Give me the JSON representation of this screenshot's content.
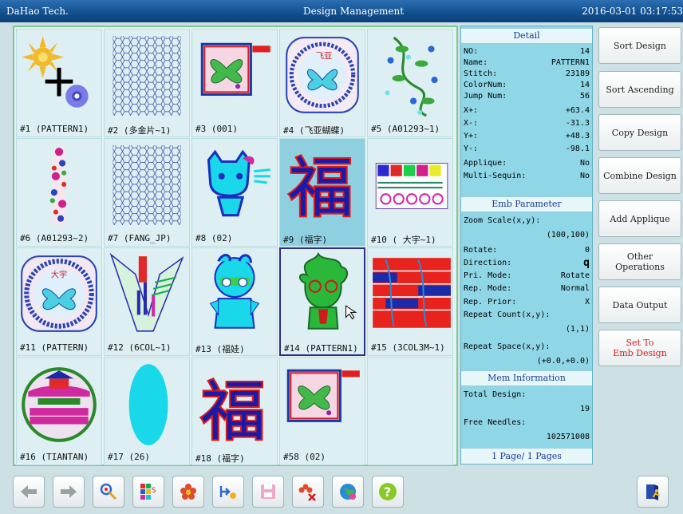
{
  "titlebar": {
    "brand": "DaHao Tech.",
    "title": "Design Management",
    "datetime": "2016-03-01 03:17:53"
  },
  "designs": [
    {
      "caption": "#1   (PATTERN1)"
    },
    {
      "caption": "#2   (多金片~1)"
    },
    {
      "caption": "#3   (001)"
    },
    {
      "caption": "#4   (飞亚蝴蝶)"
    },
    {
      "caption": "#5   (A01293~1)"
    },
    {
      "caption": "#6   (A01293~2)"
    },
    {
      "caption": "#7   (FANG_JP)"
    },
    {
      "caption": "#8   (02)"
    },
    {
      "caption": "#9   (福字)"
    },
    {
      "caption": "#10  ( 大宇~1)"
    },
    {
      "caption": "#11  (PATTERN)"
    },
    {
      "caption": "#12  (6COL~1)"
    },
    {
      "caption": "#13  (福娃)"
    },
    {
      "caption": "#14  (PATTERN1)"
    },
    {
      "caption": "#15  (3COL3M~1)"
    },
    {
      "caption": "#16  (TIANTAN)"
    },
    {
      "caption": "#17   (26)"
    },
    {
      "caption": "#18  (福字)"
    },
    {
      "caption": "#58  (02)"
    }
  ],
  "selected_index": 14,
  "detail": {
    "title": "Detail",
    "no": {
      "label": "NO:",
      "value": "14"
    },
    "name": {
      "label": "Name:",
      "value": "PATTERN1"
    },
    "stitch": {
      "label": "Stitch:",
      "value": "23189"
    },
    "colornum": {
      "label": "ColorNum:",
      "value": "14"
    },
    "jumpnum": {
      "label": "Jump Num:",
      "value": "56"
    },
    "xplus": {
      "label": "X+:",
      "value": "+63.4"
    },
    "xminus": {
      "label": "X-:",
      "value": "-31.3"
    },
    "yplus": {
      "label": "Y+:",
      "value": "+48.3"
    },
    "yminus": {
      "label": "Y-:",
      "value": "-98.1"
    },
    "applique": {
      "label": "Applique:",
      "value": "No"
    },
    "multisequin": {
      "label": "Multi-Sequin:",
      "value": "No"
    }
  },
  "emb": {
    "title": "Emb Parameter",
    "zoom_label": "Zoom Scale(x,y):",
    "zoom_value": "(100,100)",
    "rotate": {
      "label": "Rotate:",
      "value": "0"
    },
    "direction": {
      "label": "Direction:",
      "value": "q"
    },
    "pri_mode": {
      "label": "Pri. Mode:",
      "value": "Rotate"
    },
    "rep_mode": {
      "label": "Rep. Mode:",
      "value": "Normal"
    },
    "rep_prior": {
      "label": "Rep. Prior:",
      "value": "X"
    },
    "repeat_count_label": "Repeat Count(x,y):",
    "repeat_count_value": "(1,1)",
    "repeat_space_label": "Repeat Space(x,y):",
    "repeat_space_value": "(+0.0,+0.0)"
  },
  "mem": {
    "title": "Mem Information",
    "total_label": "Total Design:",
    "total_value": "19",
    "free_label": "Free Needles:",
    "free_value": "102571008"
  },
  "page_indicator": "1 Page/ 1 Pages",
  "side_buttons": {
    "sort_design": "Sort Design",
    "sort_ascending": "Sort Ascending",
    "copy_design": "Copy Design",
    "combine_design": "Combine Design",
    "add_applique": "Add Applique",
    "other_operations": "Other\nOperations",
    "data_output": "Data Output",
    "set_to_emb": "Set To\nEmb Design"
  },
  "colors": {
    "accent": "#114f8e",
    "panel": "#8fd6e6",
    "set_to_emb_text": "#d21b1b",
    "grid_border": "#7cc98c"
  },
  "toolbar_icons": [
    "arrow-left-icon",
    "arrow-right-icon",
    "preview-icon",
    "color-change-icon",
    "flower-icon",
    "import-icon",
    "save-disk-icon",
    "delete-design-icon",
    "globe-icon",
    "help-icon",
    "exit-icon"
  ]
}
